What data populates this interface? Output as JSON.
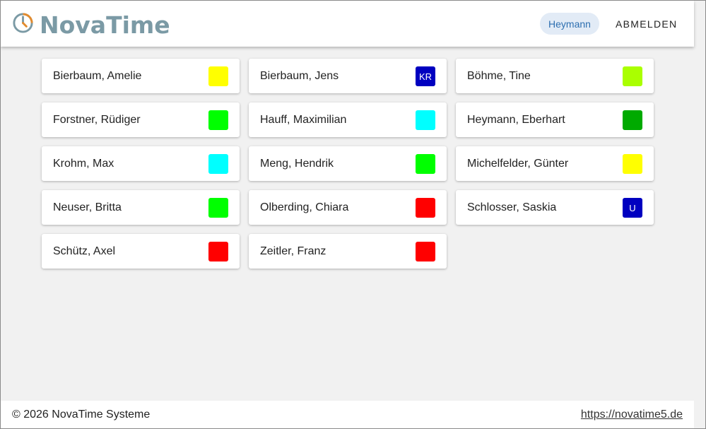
{
  "header": {
    "app_name": "NovaTime",
    "user_label": "Heymann",
    "logout_label": "ABMELDEN"
  },
  "employees": [
    {
      "name": "Bierbaum, Amelie",
      "status_color": "#ffff00",
      "badge_text": ""
    },
    {
      "name": "Bierbaum, Jens",
      "status_color": "#0000c0",
      "badge_text": "KR"
    },
    {
      "name": "Böhme, Tine",
      "status_color": "#aaff00",
      "badge_text": ""
    },
    {
      "name": "Forstner, Rüdiger",
      "status_color": "#00ff00",
      "badge_text": ""
    },
    {
      "name": "Hauff, Maximilian",
      "status_color": "#00ffff",
      "badge_text": ""
    },
    {
      "name": "Heymann, Eberhart",
      "status_color": "#00aa00",
      "badge_text": ""
    },
    {
      "name": "Krohm, Max",
      "status_color": "#00ffff",
      "badge_text": ""
    },
    {
      "name": "Meng, Hendrik",
      "status_color": "#00ff00",
      "badge_text": ""
    },
    {
      "name": "Michelfelder, Günter",
      "status_color": "#ffff00",
      "badge_text": ""
    },
    {
      "name": "Neuser, Britta",
      "status_color": "#00ff00",
      "badge_text": ""
    },
    {
      "name": "Olberding, Chiara",
      "status_color": "#ff0000",
      "badge_text": ""
    },
    {
      "name": "Schlosser, Saskia",
      "status_color": "#0000c0",
      "badge_text": "U"
    },
    {
      "name": "Schütz, Axel",
      "status_color": "#ff0000",
      "badge_text": ""
    },
    {
      "name": "Zeitler, Franz",
      "status_color": "#ff0000",
      "badge_text": ""
    }
  ],
  "footer": {
    "copyright": "© 2026 NovaTime Systeme",
    "link": "https://novatime5.de"
  },
  "icons": {
    "logo": "clock-icon"
  },
  "colors": {
    "brand": "#7b9aa5",
    "accent": "#e38b2d",
    "chip_bg": "#e2ebf6",
    "chip_text": "#2d6fb0"
  }
}
